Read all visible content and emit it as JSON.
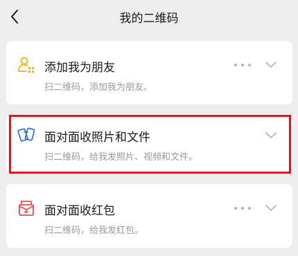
{
  "navbar": {
    "title": "我的二维码",
    "back_icon": "chevron-left-icon"
  },
  "options": [
    {
      "title": "添加我为朋友",
      "subtitle": "扫二维码，添加我为朋友。",
      "icon": "add-friend-icon",
      "icon_color": "#f0b400",
      "has_more": true,
      "highlighted": false
    },
    {
      "title": "面对面收照片和文件",
      "subtitle": "扫二维码，给我发照片、视频和文件。",
      "icon": "file-transfer-icon",
      "icon_color": "#2b6de3",
      "has_more": false,
      "highlighted": true
    },
    {
      "title": "面对面收红包",
      "subtitle": "扫二维码，给我发红包。",
      "icon": "red-packet-icon",
      "icon_color": "#f0494b",
      "has_more": true,
      "highlighted": false
    }
  ],
  "highlight_color": "#e8101b"
}
